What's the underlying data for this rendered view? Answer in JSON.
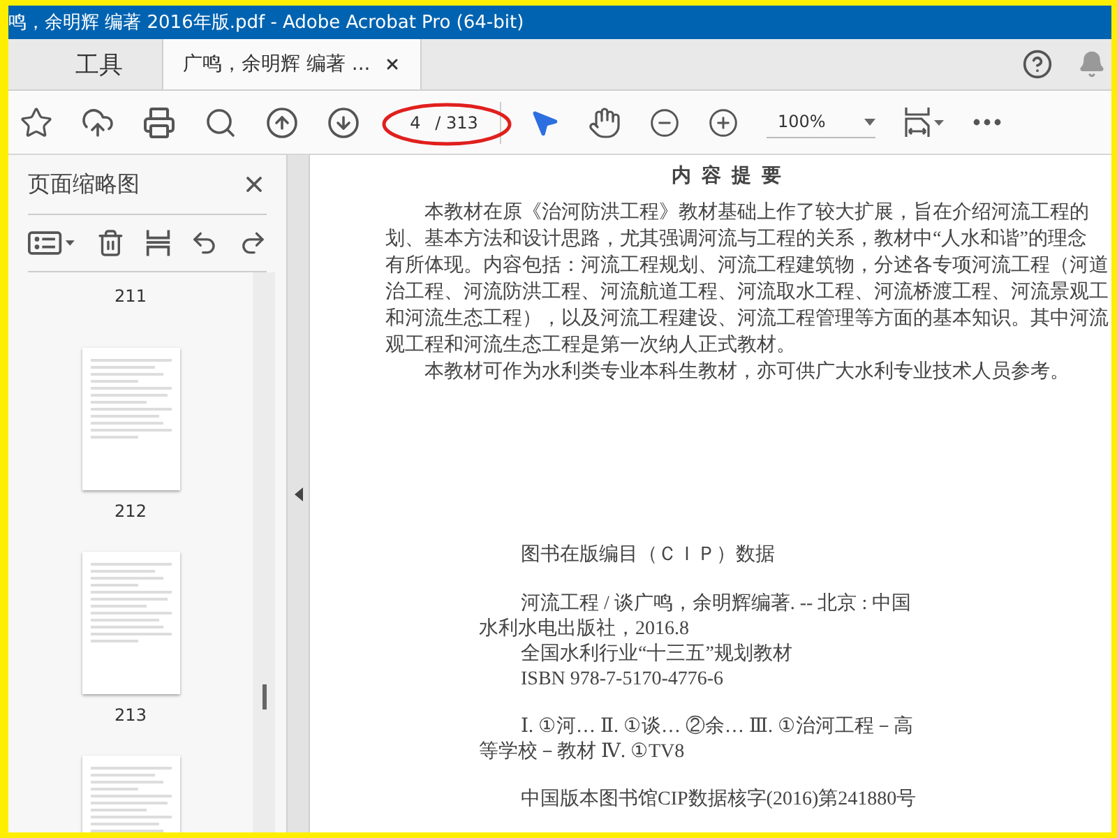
{
  "window": {
    "title": "鸣，余明辉 编著 2016年版.pdf - Adobe Acrobat Pro (64-bit)"
  },
  "tabs": [
    {
      "label": "工具",
      "selected": false,
      "closable": false
    },
    {
      "label": "广鸣，余明辉 编著 ...",
      "selected": true,
      "closable": true
    }
  ],
  "toolbar": {
    "page_current": "4",
    "page_total": "/ 313",
    "zoom": "100%"
  },
  "thumbnail_panel": {
    "title": "页面缩略图",
    "pages": [
      {
        "label": "211",
        "kind": "cut"
      },
      {
        "label": "212",
        "kind": "full"
      },
      {
        "label": "213",
        "kind": "full"
      }
    ]
  },
  "document": {
    "heading": "内 容 提 要",
    "abstract_lines": [
      {
        "text": "本教材在原《治河防洪工程》教材基础上作了较大扩展，旨在介绍河流工程的",
        "kind": "indent"
      },
      {
        "text": "划、基本方法和设计思路，尤其强调河流与工程的关系，教材中“人水和谐”的理念",
        "kind": "flush"
      },
      {
        "text": "有所体现。内容包括：河流工程规划、河流工程建筑物，分述各专项河流工程（河道",
        "kind": "flush"
      },
      {
        "text": "治工程、河流防洪工程、河流航道工程、河流取水工程、河流桥渡工程、河流景观工",
        "kind": "flush"
      },
      {
        "text": "和河流生态工程），以及河流工程建设、河流工程管理等方面的基本知识。其中河流",
        "kind": "flush"
      },
      {
        "text": "观工程和河流生态工程是第一次纳人正式教材。",
        "kind": "flush"
      },
      {
        "text": "本教材可作为水利类专业本科生教材，亦可供广大水利专业技术人员参考。",
        "kind": "indent"
      }
    ],
    "cip_title": "图书在版编目（ＣＩＰ）数据",
    "cip_lines": [
      {
        "text": "河流工程 / 谈广鸣，余明辉编著. -- 北京 : 中国",
        "kind": "indent"
      },
      {
        "text": "水利水电出版社，2016.8",
        "kind": "flush"
      },
      {
        "text": "全国水利行业“十三五”规划教材",
        "kind": "indent"
      },
      {
        "text": "ISBN 978-7-5170-4776-6",
        "kind": "indent"
      },
      {
        "text": "Ⅰ. ①河… Ⅱ. ①谈… ②余… Ⅲ. ①治河工程－高",
        "kind": "indent-gap"
      },
      {
        "text": "等学校－教材 Ⅳ. ①TV8",
        "kind": "flush"
      },
      {
        "text": "中国版本图书馆CIP数据核字(2016)第241880号",
        "kind": "indent-gap"
      }
    ]
  }
}
